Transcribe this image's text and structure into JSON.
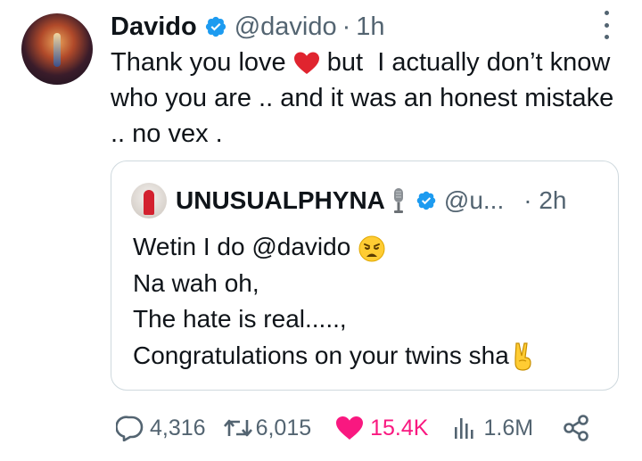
{
  "tweet": {
    "author_name": "Davido",
    "handle": "@davido",
    "separator": "·",
    "time": "1h",
    "text_parts": {
      "before_emoji": "Thank you love ",
      "after_emoji": " but  I actually don’t know who you are .. and it was an honest mistake .. no vex ."
    }
  },
  "quoted": {
    "author_name": "UNUSUALPHYNA",
    "handle": "@u...",
    "time": "· 2h",
    "lines": [
      "Wetin I do @davido ",
      "Na wah oh,",
      "The hate is real.....,",
      "Congratulations on your twins sha"
    ]
  },
  "actions": {
    "replies": "4,316",
    "reposts": "6,015",
    "likes": "15.4K",
    "views": "1.6M"
  },
  "colors": {
    "verified": "#1d9bf0",
    "like": "#f91880",
    "secondary_text": "#536471",
    "border": "#cfd9de"
  },
  "icons": [
    "verified-badge-icon",
    "heart-emoji",
    "more-icon",
    "microphone-icon",
    "weary-face-emoji",
    "victory-hand-emoji",
    "reply-icon",
    "repost-icon",
    "like-icon",
    "views-icon",
    "share-icon"
  ]
}
